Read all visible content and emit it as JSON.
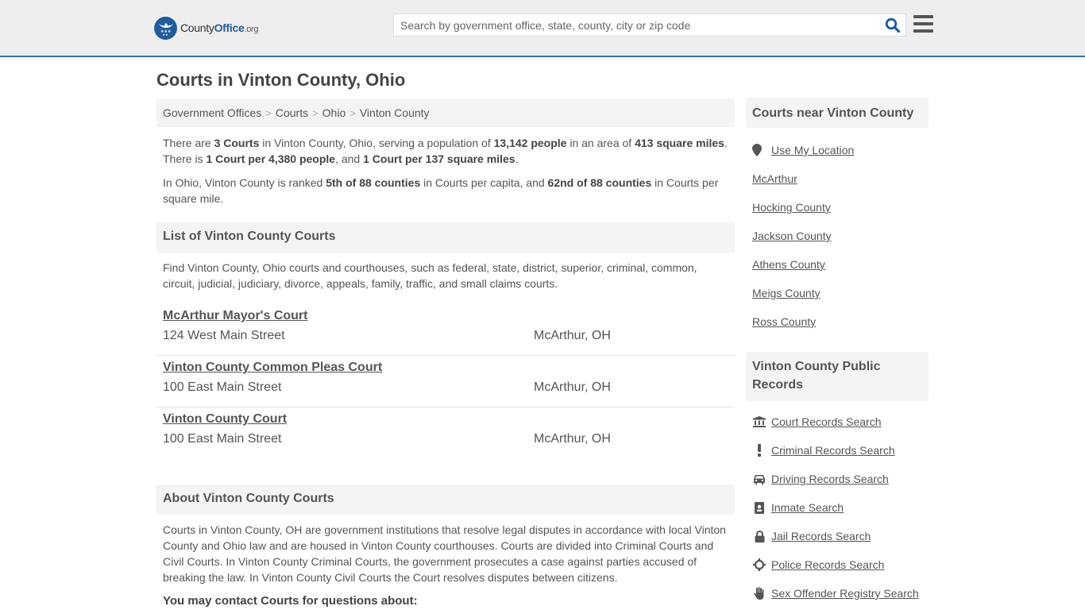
{
  "header": {
    "logo": {
      "brand_prefix": "County",
      "brand_main": "Office",
      "brand_suffix": ".org"
    },
    "search": {
      "placeholder": "Search by government office, state, county, city or zip code",
      "value": ""
    },
    "colors": {
      "accent": "#2e74b5",
      "brand": "#1f5c9c",
      "header_bg": "#eeeeee"
    }
  },
  "page": {
    "title": "Courts in Vinton County, Ohio"
  },
  "breadcrumb": [
    {
      "label": "Government Offices"
    },
    {
      "label": "Courts"
    },
    {
      "label": "Ohio"
    },
    {
      "label": "Vinton County"
    }
  ],
  "summary": {
    "p1": {
      "t1": "There are ",
      "b1": "3 Courts",
      "t2": " in Vinton County, Ohio, serving a population of ",
      "b2": "13,142 people",
      "t3": " in an area of ",
      "b3": "413 square miles",
      "t4": ". There is ",
      "b4": "1 Court per 4,380 people",
      "t5": ", and ",
      "b5": "1 Court per 137 square miles",
      "t6": "."
    },
    "p2": {
      "t1": "In Ohio, Vinton County is ranked ",
      "b1": "5th of 88 counties",
      "t2": " in Courts per capita, and ",
      "b2": "62nd of 88 counties",
      "t3": " in Courts per square mile."
    }
  },
  "list_section": {
    "heading": "List of Vinton County Courts",
    "intro": "Find Vinton County, Ohio courts and courthouses, such as federal, state, district, superior, criminal, common, circuit, judicial, judiciary, divorce, appeals, family, traffic, and small claims courts.",
    "courts": [
      {
        "name": "McArthur Mayor's Court",
        "address": "124 West Main Street",
        "city": "McArthur, OH"
      },
      {
        "name": "Vinton County Common Pleas Court",
        "address": "100 East Main Street",
        "city": "McArthur, OH"
      },
      {
        "name": "Vinton County Court",
        "address": "100 East Main Street",
        "city": "McArthur, OH"
      }
    ]
  },
  "about_section": {
    "heading": "About Vinton County Courts",
    "body": "Courts in Vinton County, OH are government institutions that resolve legal disputes in accordance with local Vinton County and Ohio law and are housed in Vinton County courthouses. Courts are divided into Criminal Courts and Civil Courts. In Vinton County Criminal Courts, the government prosecutes a case against parties accused of breaking the law. In Vinton County Civil Courts the Court resolves disputes between citizens.",
    "contact_heading": "You may contact Courts for questions about:"
  },
  "sidebar": {
    "nearby": {
      "heading": "Courts near Vinton County",
      "location_link": {
        "label": "Use My Location",
        "icon": "map-marker-icon"
      },
      "links": [
        {
          "label": "McArthur"
        },
        {
          "label": "Hocking County"
        },
        {
          "label": "Jackson County"
        },
        {
          "label": "Athens County"
        },
        {
          "label": "Meigs County"
        },
        {
          "label": "Ross County"
        }
      ]
    },
    "records": {
      "heading": "Vinton County Public Records",
      "links": [
        {
          "label": "Court Records Search",
          "icon": "courthouse-icon"
        },
        {
          "label": "Criminal Records Search",
          "icon": "exclamation-icon"
        },
        {
          "label": "Driving Records Search",
          "icon": "car-icon"
        },
        {
          "label": "Inmate Search",
          "icon": "id-badge-icon"
        },
        {
          "label": "Jail Records Search",
          "icon": "lock-icon"
        },
        {
          "label": "Police Records Search",
          "icon": "crosshairs-icon"
        },
        {
          "label": "Sex Offender Registry Search",
          "icon": "hand-icon"
        }
      ]
    }
  }
}
